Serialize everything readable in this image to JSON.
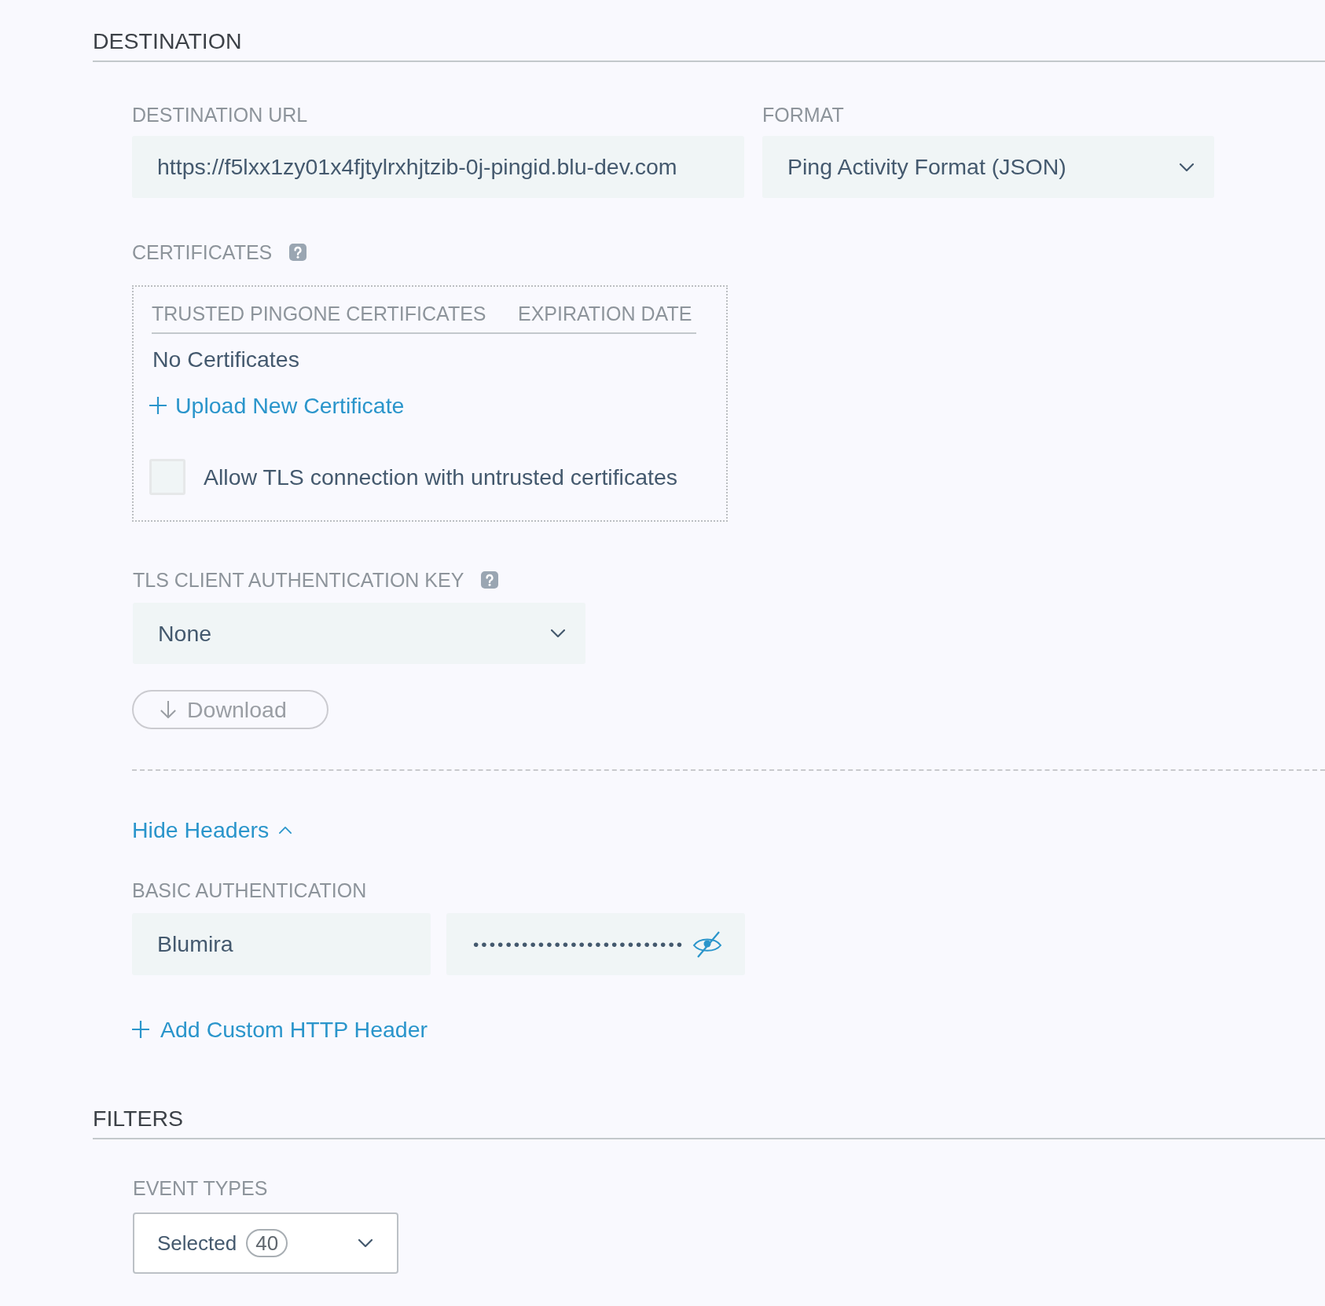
{
  "destination": {
    "heading": "DESTINATION",
    "url": {
      "label": "DESTINATION URL",
      "value": "https://f5lxx1zy01x4fjtylrxhjtzib-0j-pingid.blu-dev.com"
    },
    "format": {
      "label": "FORMAT",
      "value": "Ping Activity Format (JSON)"
    },
    "certificates": {
      "label": "CERTIFICATES",
      "columns": [
        "TRUSTED PINGONE CERTIFICATES",
        "EXPIRATION DATE"
      ],
      "empty_text": "No Certificates",
      "upload_link": "Upload New Certificate",
      "allow_untrusted": {
        "label": "Allow TLS connection with untrusted certificates",
        "checked": false
      }
    },
    "tls_client_key": {
      "label": "TLS CLIENT AUTHENTICATION KEY",
      "value": "None",
      "download_button": {
        "label": "Download",
        "disabled": true
      }
    },
    "headers_toggle": {
      "label": "Hide Headers",
      "expanded": true
    },
    "basic_auth": {
      "label": "BASIC AUTHENTICATION",
      "username": "Blumira",
      "password": "••••••••••••••••••••••••••"
    },
    "add_header_link": "Add Custom HTTP Header"
  },
  "filters": {
    "heading": "FILTERS",
    "event_types": {
      "label": "EVENT TYPES",
      "value": "Selected",
      "count": "40"
    }
  }
}
